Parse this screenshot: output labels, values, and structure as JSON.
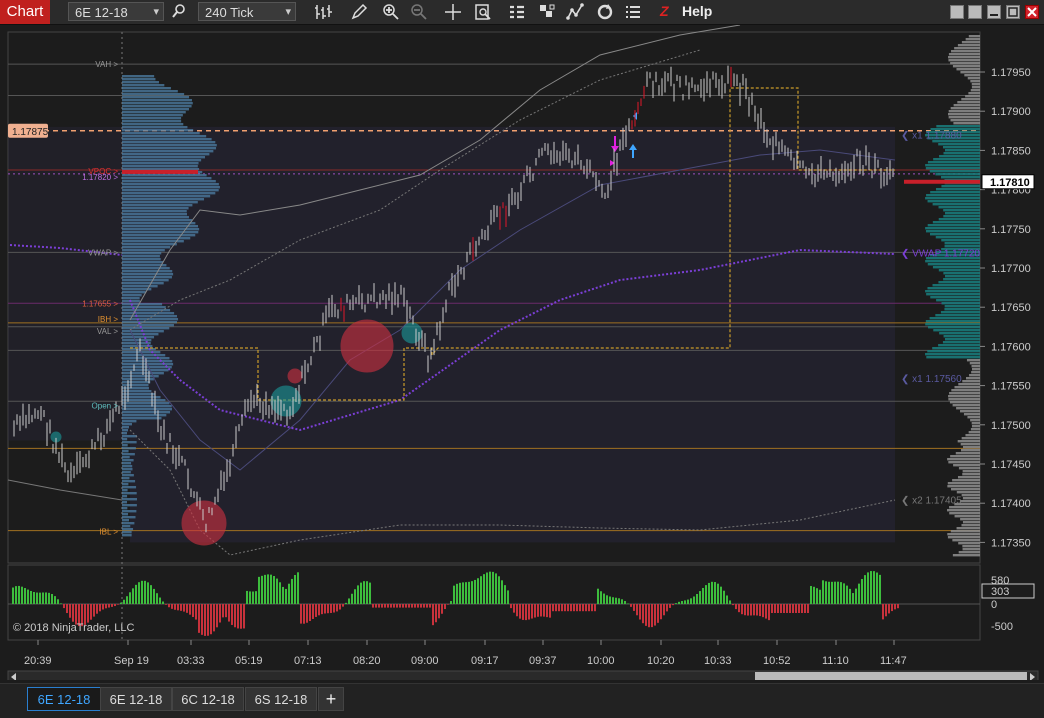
{
  "toolbar": {
    "chart_label": "Chart",
    "instrument": "6E 12-18",
    "interval": "240 Tick",
    "help_label": "Help",
    "z_label": "Z",
    "dropdown_arrow": "▾"
  },
  "icons": [
    "magnifier-icon",
    "bar-style-icon",
    "pencil-icon",
    "zoom-in-icon",
    "zoom-out-icon",
    "crosshair-icon",
    "data-box-icon",
    "strategies-icon",
    "indicators-icon",
    "drawing-tools-icon",
    "reload-icon",
    "properties-icon"
  ],
  "colors": {
    "background": "#1c1c1c",
    "up": "#cccccc",
    "down_red": "#e0182a",
    "volume_up": "#3dbd3d",
    "volume_down": "#c8323c",
    "vwap": "#7b3fd6",
    "poc": "#c8202a",
    "profile_teal": "#1a7a7a",
    "profile_blue": "#4d7fa6"
  },
  "price_axis": {
    "ticks": [
      "1.17950",
      "1.17900",
      "1.17850",
      "1.17800",
      "1.17750",
      "1.17700",
      "1.17650",
      "1.17600",
      "1.17550",
      "1.17500",
      "1.17450",
      "1.17400",
      "1.17350"
    ],
    "current_price": "1.17810",
    "dashed_level": "1.17875"
  },
  "volume_axis": {
    "ticks": [
      "500",
      "0",
      "-500"
    ],
    "current": "303",
    "top_tick": "580"
  },
  "time_axis": [
    "20:39",
    "Sep 19",
    "03:33",
    "05:19",
    "07:13",
    "08:20",
    "09:00",
    "09:17",
    "09:37",
    "10:00",
    "10:20",
    "10:33",
    "10:52",
    "11:10",
    "11:47"
  ],
  "left_labels": {
    "vah": "VAH",
    "vpoc": "VPOC",
    "level_1": "1.17820",
    "vwap": "VWAP",
    "level_2": "1.17655",
    "ibh": "IBH",
    "val": "VAL",
    "open": "Open",
    "ibl": "IBL",
    "marker": ">"
  },
  "right_labels": {
    "x1_upper": "x1 1.17880",
    "vwap": "VWAP 1.17720",
    "x1_lower": "x1 1.17560",
    "x2_lower": "x2 1.17405",
    "prefix": "❮"
  },
  "copyright": "© 2018 NinjaTrader, LLC",
  "tabs": [
    "6E 12-18",
    "6E 12-18",
    "6C 12-18",
    "6S 12-18"
  ],
  "add_tab": "+"
}
